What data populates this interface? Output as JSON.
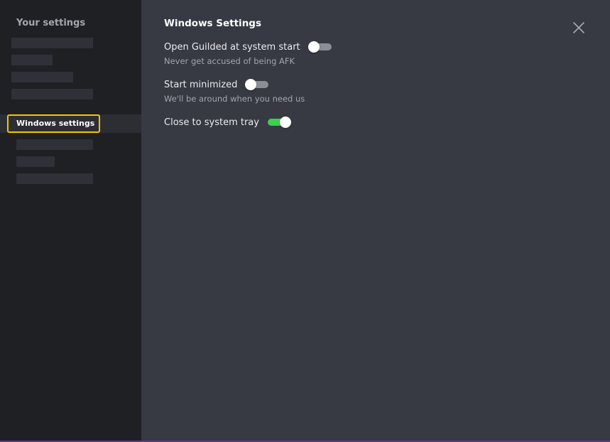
{
  "sidebar": {
    "heading": "Your settings",
    "active_item": "Windows settings"
  },
  "main": {
    "title": "Windows Settings",
    "settings": [
      {
        "label": "Open Guilded at system start",
        "description": "Never get accused of being AFK",
        "enabled": false
      },
      {
        "label": "Start minimized",
        "description": "We'll be around when you need us",
        "enabled": false
      },
      {
        "label": "Close to system tray",
        "enabled": true
      }
    ]
  },
  "colors": {
    "main_background": "#373943",
    "sidebar_background": "#1f2024",
    "highlight": "#f5c400",
    "toggle_on": "#3ecf4e",
    "toggle_off": "#8c8e95",
    "accent_bar": "#5a3b8f"
  },
  "icons": {
    "close": "close-icon"
  }
}
